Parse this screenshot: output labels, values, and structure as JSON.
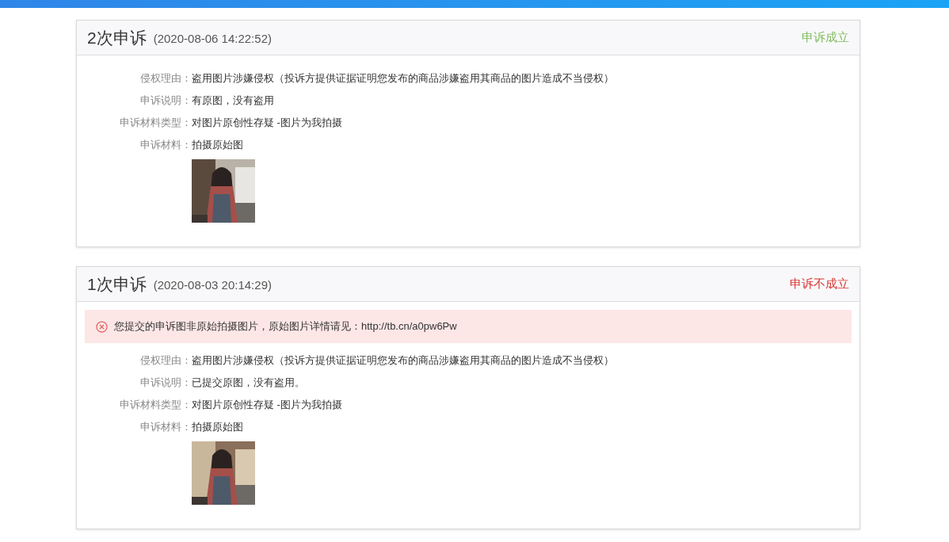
{
  "appeals": [
    {
      "title": "2次申诉",
      "time": "(2020-08-06 14:22:52)",
      "status": {
        "text": "申诉成立",
        "kind": "success"
      },
      "fields": [
        {
          "label": "侵权理由：",
          "value": "盗用图片涉嫌侵权（投诉方提供证据证明您发布的商品涉嫌盗用其商品的图片造成不当侵权）"
        },
        {
          "label": "申诉说明：",
          "value": "有原图，没有盗用"
        },
        {
          "label": "申诉材料类型：",
          "value": "对图片原创性存疑 -图片为我拍摄"
        },
        {
          "label": "申诉材料：",
          "value": "拍摄原始图"
        }
      ]
    },
    {
      "title": "1次申诉",
      "time": "(2020-08-03 20:14:29)",
      "status": {
        "text": "申诉不成立",
        "kind": "fail"
      },
      "notice": "您提交的申诉图非原始拍摄图片，原始图片详情请见：http://tb.cn/a0pw6Pw",
      "fields": [
        {
          "label": "侵权理由：",
          "value": "盗用图片涉嫌侵权（投诉方提供证据证明您发布的商品涉嫌盗用其商品的图片造成不当侵权）"
        },
        {
          "label": "申诉说明：",
          "value": "已提交原图，没有盗用。"
        },
        {
          "label": "申诉材料类型：",
          "value": "对图片原创性存疑 -图片为我拍摄"
        },
        {
          "label": "申诉材料：",
          "value": "拍摄原始图"
        }
      ]
    }
  ]
}
